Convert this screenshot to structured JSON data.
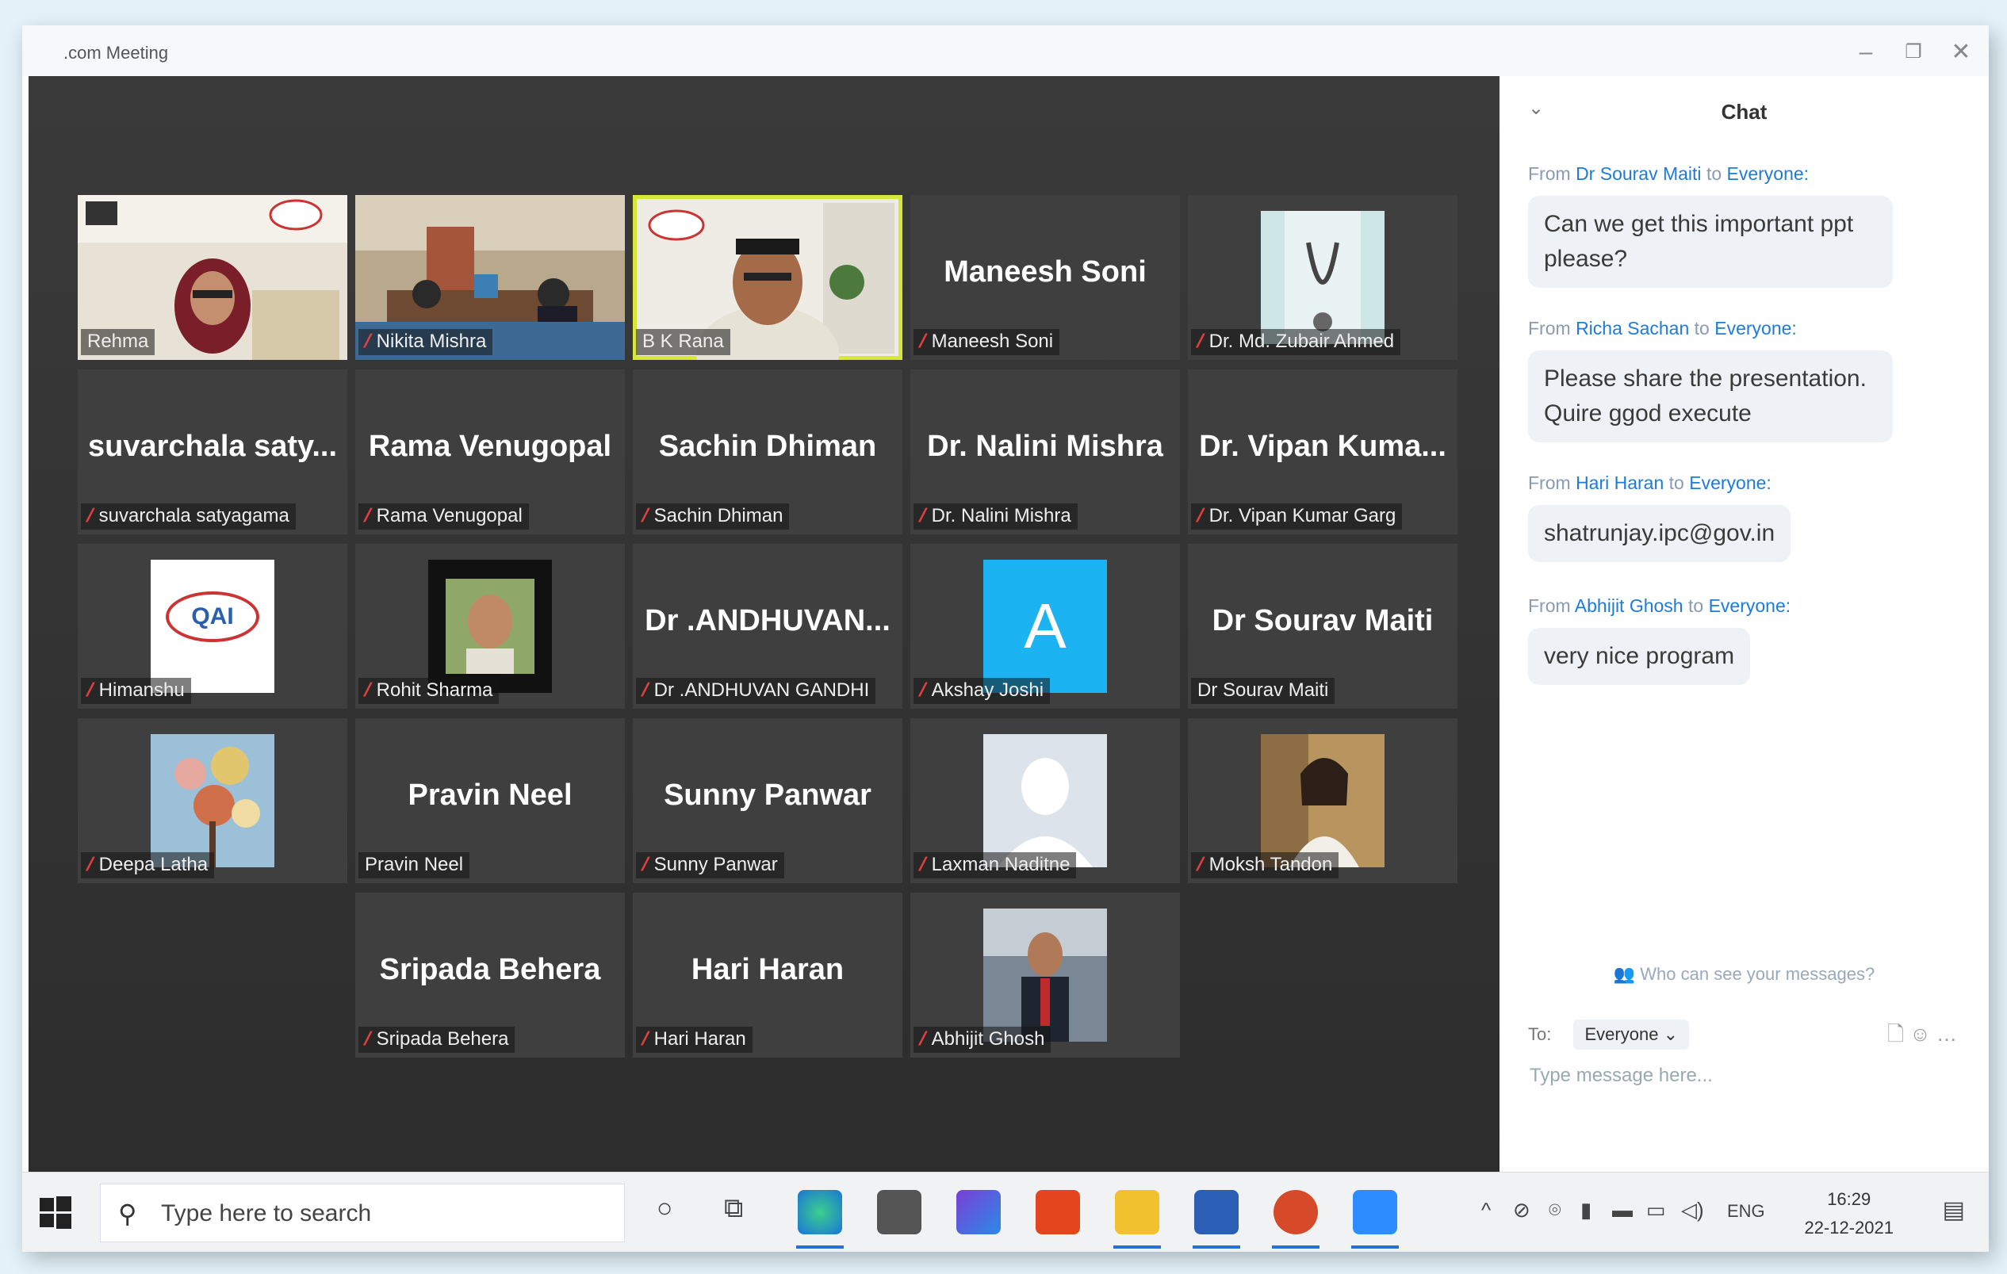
{
  "window": {
    "title": ".com Meeting"
  },
  "tiles": [
    {
      "label": "Rehma",
      "center": "",
      "kind": "video",
      "muted": false
    },
    {
      "label": "Nikita Mishra",
      "center": "",
      "kind": "video",
      "muted": true
    },
    {
      "label": "B K Rana",
      "center": "",
      "kind": "video",
      "muted": false,
      "active": true
    },
    {
      "label": "Maneesh Soni",
      "center": "Maneesh Soni",
      "kind": "name",
      "muted": true
    },
    {
      "label": "Dr. Md. Zubair Ahmed",
      "center": "",
      "kind": "thumb",
      "muted": true
    },
    {
      "label": "suvarchala satyagama",
      "center": "suvarchala  saty...",
      "kind": "name",
      "muted": true
    },
    {
      "label": "Rama Venugopal",
      "center": "Rama Venugopal",
      "kind": "name",
      "muted": true
    },
    {
      "label": "Sachin Dhiman",
      "center": "Sachin Dhiman",
      "kind": "name",
      "muted": true
    },
    {
      "label": "Dr. Nalini Mishra",
      "center": "Dr. Nalini Mishra",
      "kind": "name",
      "muted": true
    },
    {
      "label": "Dr. Vipan Kumar Garg",
      "center": "Dr. Vipan  Kuma...",
      "kind": "name",
      "muted": true
    },
    {
      "label": "Himanshu",
      "center": "",
      "kind": "thumb",
      "muted": true,
      "thumb_text": "QAI"
    },
    {
      "label": "Rohit Sharma",
      "center": "",
      "kind": "thumb",
      "muted": true
    },
    {
      "label": "Dr .ANDHUVAN GANDHI",
      "center": "Dr  .ANDHUVAN...",
      "kind": "name",
      "muted": true
    },
    {
      "label": "Akshay Joshi",
      "center": "",
      "kind": "avatar",
      "muted": true,
      "thumb_text": "A"
    },
    {
      "label": "Dr Sourav Maiti",
      "center": "Dr Sourav Maiti",
      "kind": "name",
      "muted": false
    },
    {
      "label": "Deepa Latha",
      "center": "",
      "kind": "thumb",
      "muted": true
    },
    {
      "label": "Pravin Neel",
      "center": "Pravin Neel",
      "kind": "name",
      "muted": false
    },
    {
      "label": "Sunny Panwar",
      "center": "Sunny Panwar",
      "kind": "name",
      "muted": true
    },
    {
      "label": "Laxman Naditne",
      "center": "",
      "kind": "thumb",
      "muted": true
    },
    {
      "label": "Moksh Tandon",
      "center": "",
      "kind": "thumb",
      "muted": true
    },
    {
      "label": "Sripada Behera",
      "center": "Sripada Behera",
      "kind": "name",
      "muted": true
    },
    {
      "label": "Hari Haran",
      "center": "Hari Haran",
      "kind": "name",
      "muted": true
    },
    {
      "label": "Abhijit Ghosh",
      "center": "",
      "kind": "thumb",
      "muted": true
    }
  ],
  "chat": {
    "title": "Chat",
    "messages": [
      {
        "from_prefix": "From",
        "from": "Dr Sourav Maiti",
        "to_word": "to",
        "to": "Everyone:",
        "text": "Can we get this important ppt please?"
      },
      {
        "from_prefix": "From",
        "from": "Richa Sachan",
        "to_word": "to",
        "to": "Everyone:",
        "text": "Please share the presentation. Quire ggod execute"
      },
      {
        "from_prefix": "From",
        "from": "Hari Haran",
        "to_word": "to",
        "to": "Everyone:",
        "text": "shatrunjay.ipc@gov.in"
      },
      {
        "from_prefix": "From",
        "from": "Abhijit Ghosh",
        "to_word": "to",
        "to": "Everyone:",
        "text": "very nice program"
      }
    ],
    "who_can_see": "Who can see your messages?",
    "to_label": "To:",
    "to_value": "Everyone",
    "input_placeholder": "Type message here..."
  },
  "taskbar": {
    "search_placeholder": "Type here to search",
    "language": "ENG",
    "time": "16:29",
    "date": "22-12-2021"
  },
  "colors": {
    "active_speaker": "#d5e83a",
    "link": "#1f7bd8",
    "muted_mic": "#e04040"
  }
}
